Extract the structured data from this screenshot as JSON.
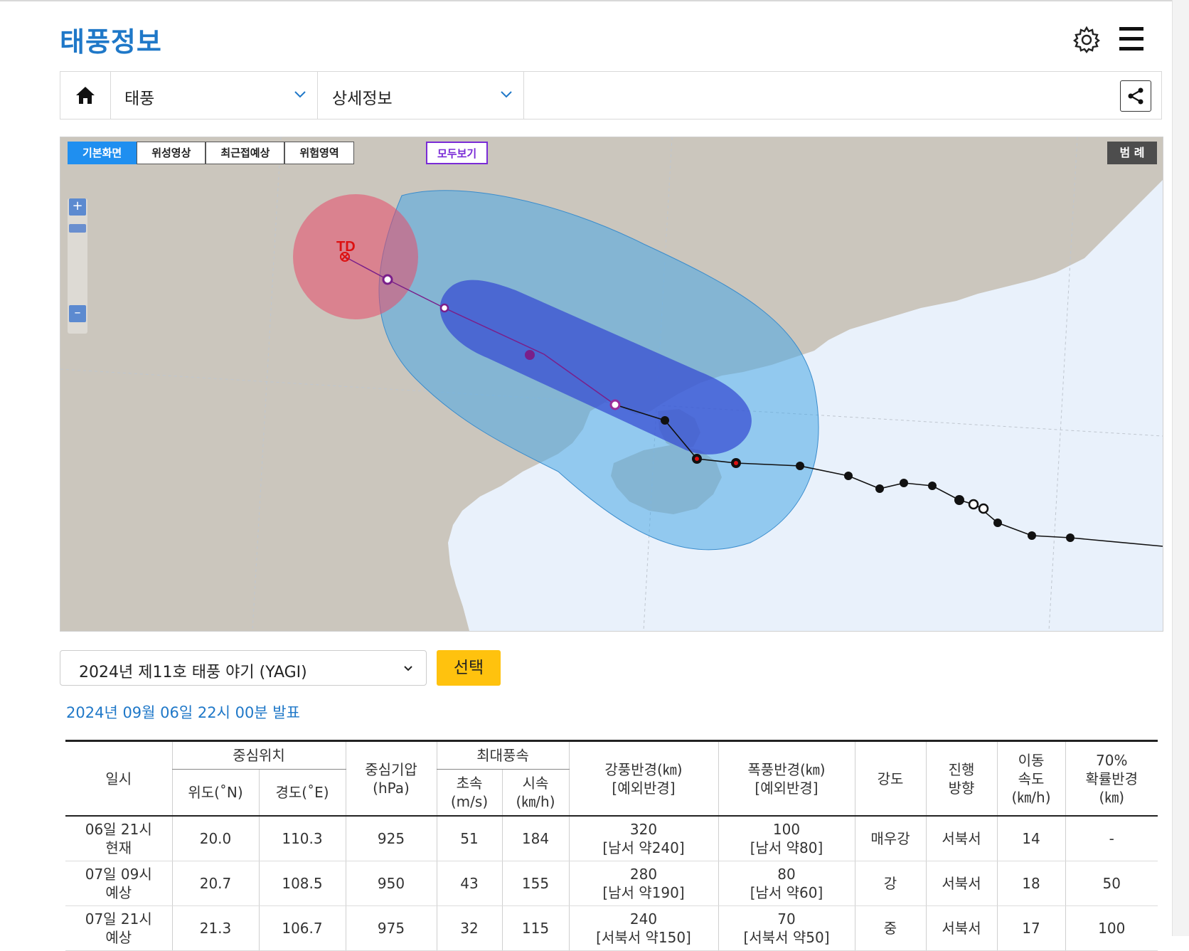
{
  "header": {
    "title": "태풍정보"
  },
  "nav": {
    "dropdown1": "태풍",
    "dropdown2": "상세정보"
  },
  "map": {
    "buttons": [
      "기본화면",
      "위성영상",
      "최근접예상",
      "위험영역"
    ],
    "view_all": "모두보기",
    "legend": "범 례",
    "zoom_in": "+",
    "zoom_out": "–",
    "td_label": "TD"
  },
  "typhoon_select": {
    "value": "2024년 제11호 태풍 야기 (YAGI)",
    "button": "선택"
  },
  "announcement": "2024년 09월 06일 22시 00분 발표",
  "table": {
    "headers": {
      "datetime": "일시",
      "center_position": "중심위치",
      "lat": "위도(˚N)",
      "lon": "경도(˚E)",
      "pressure": "중심기압",
      "pressure_unit": "(hPa)",
      "max_wind": "최대풍속",
      "wind_ms": "초속",
      "wind_ms_unit": "(m/s)",
      "wind_kmh": "시속",
      "wind_kmh_unit": "(㎞/h)",
      "strong_radius": "강풍반경(㎞)",
      "strong_radius_sub": "[예외반경]",
      "storm_radius": "폭풍반경(㎞)",
      "storm_radius_sub": "[예외반경]",
      "intensity": "강도",
      "direction_1": "진행",
      "direction_2": "방향",
      "speed_1": "이동",
      "speed_2": "속도",
      "speed_3": "(㎞/h)",
      "prob_1": "70%",
      "prob_2": "확률반경",
      "prob_3": "(㎞)"
    },
    "rows": [
      {
        "date": "06일 21시",
        "type": "현재",
        "lat": "20.0",
        "lon": "110.3",
        "pressure": "925",
        "ms": "51",
        "kmh": "184",
        "strong": "320",
        "strong_ex": "[남서 약240]",
        "storm": "100",
        "storm_ex": "[남서 약80]",
        "intensity": "매우강",
        "direction": "서북서",
        "speed": "14",
        "prob": "-"
      },
      {
        "date": "07일 09시",
        "type": "예상",
        "lat": "20.7",
        "lon": "108.5",
        "pressure": "950",
        "ms": "43",
        "kmh": "155",
        "strong": "280",
        "strong_ex": "[남서 약190]",
        "storm": "80",
        "storm_ex": "[남서 약60]",
        "intensity": "강",
        "direction": "서북서",
        "speed": "18",
        "prob": "50"
      },
      {
        "date": "07일 21시",
        "type": "예상",
        "lat": "21.3",
        "lon": "106.7",
        "pressure": "975",
        "ms": "32",
        "kmh": "115",
        "strong": "240",
        "strong_ex": "[서북서 약150]",
        "storm": "70",
        "storm_ex": "[서북서 약50]",
        "intensity": "중",
        "direction": "서북서",
        "speed": "17",
        "prob": "100"
      }
    ]
  },
  "colors": {
    "title_blue": "#1f78c8",
    "active_btn": "#1f8ff0",
    "select_btn": "#ffc20e",
    "strong_wind_area": "#4aa8e6",
    "storm_area": "#3347d1",
    "td_area": "#e84a6a"
  }
}
